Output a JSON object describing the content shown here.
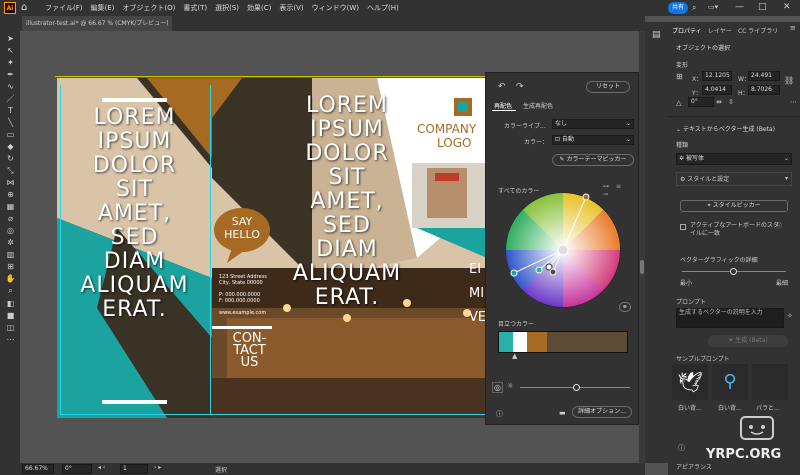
{
  "menubar": {
    "items": [
      "ファイル(F)",
      "編集(E)",
      "オブジェクト(O)",
      "書式(T)",
      "選択(S)",
      "効果(C)",
      "表示(V)",
      "ウィンドウ(W)",
      "ヘルプ(H)"
    ],
    "app_logo": "Ai",
    "share_label": "共有"
  },
  "document": {
    "tab_title": "illustrator-test.ai* @ 66.67 % (CMYK/プレビュー)"
  },
  "artwork": {
    "col1_text": [
      "LOREM",
      "IPSUM",
      "DOLOR",
      "SIT",
      "AMET,",
      "SED",
      "DIAM",
      "ALIQUAM",
      "ERAT."
    ],
    "col3_text": [
      "LOREM",
      "IPSUM",
      "DOLOR",
      "SIT",
      "AMET,",
      "SED",
      "DIAM",
      "ALIQUAM",
      "ERAT."
    ],
    "say_hello": [
      "SAY",
      "HELLO"
    ],
    "address": [
      "123 Street Address",
      "City, State 00000",
      "",
      "P: 000.000.0000",
      "F: 000.000.0000",
      "",
      "www.example.com"
    ],
    "contact": [
      "CON-",
      "TACT",
      "US"
    ],
    "company_logo": [
      "COMPANY",
      "LOGO"
    ],
    "right_partial": [
      "EI",
      "MI",
      "VEN"
    ],
    "colors": {
      "teal": "#1aa39f",
      "brown": "#a66a23",
      "tan": "#d9c4a8",
      "dark": "#3b3226"
    }
  },
  "color_panel": {
    "reset_label": "リセット",
    "tabs": [
      "再配色",
      "生成再配色"
    ],
    "color_library_label": "カラーライブ...",
    "color_library_value": "なし",
    "color_label": "カラー：",
    "color_value": "自動",
    "color_theme_picker": "カラーテーマピッカー",
    "all_colors_label": "すべてのカラー",
    "prominent_colors_label": "目立つカラー",
    "prominent_swatches": [
      "#2bb0a8",
      "#ffffff",
      "#a66a23",
      "#5c4b36"
    ],
    "options_label": "詳細オプション..."
  },
  "right_panel": {
    "tabs": [
      "プロパティ",
      "レイヤー",
      "CC ライブラリ"
    ],
    "section_title": "オブジェクトの選択",
    "transform_label": "変形",
    "x_label": "X：",
    "x_value": "12.1205",
    "y_label": "Y：",
    "y_value": "4.0414",
    "w_label": "W：",
    "w_value": "24.491",
    "h_label": "H：",
    "h_value": "8.7026",
    "angle_value": "0°",
    "text_to_vector_title": "テキストからベクター生成 (Beta)",
    "type_label": "種類",
    "type_value": "被写体",
    "style_settings_label": "スタイルと設定",
    "style_picker_label": "スタイルピッカー",
    "active_artboard_checkbox": "アクティブなアートボードのスタイルに一致",
    "detail_label": "ベクターグラフィックの詳細",
    "detail_min": "最小",
    "detail_max": "最細",
    "prompt_label": "プロンプト",
    "prompt_placeholder": "生成するベクターの説明を入力",
    "generate_button": "生成 (Beta)",
    "sample_prompts_label": "サンプルプロンプト",
    "sample_labels": [
      "白い背...",
      "白い背...",
      "パラと..."
    ],
    "appearance_label": "アピアランス"
  },
  "statusbar": {
    "zoom": "66.67%",
    "angle": "0°",
    "artboard_num": "1",
    "mode": "選択"
  },
  "watermark": "YRPC.ORG"
}
